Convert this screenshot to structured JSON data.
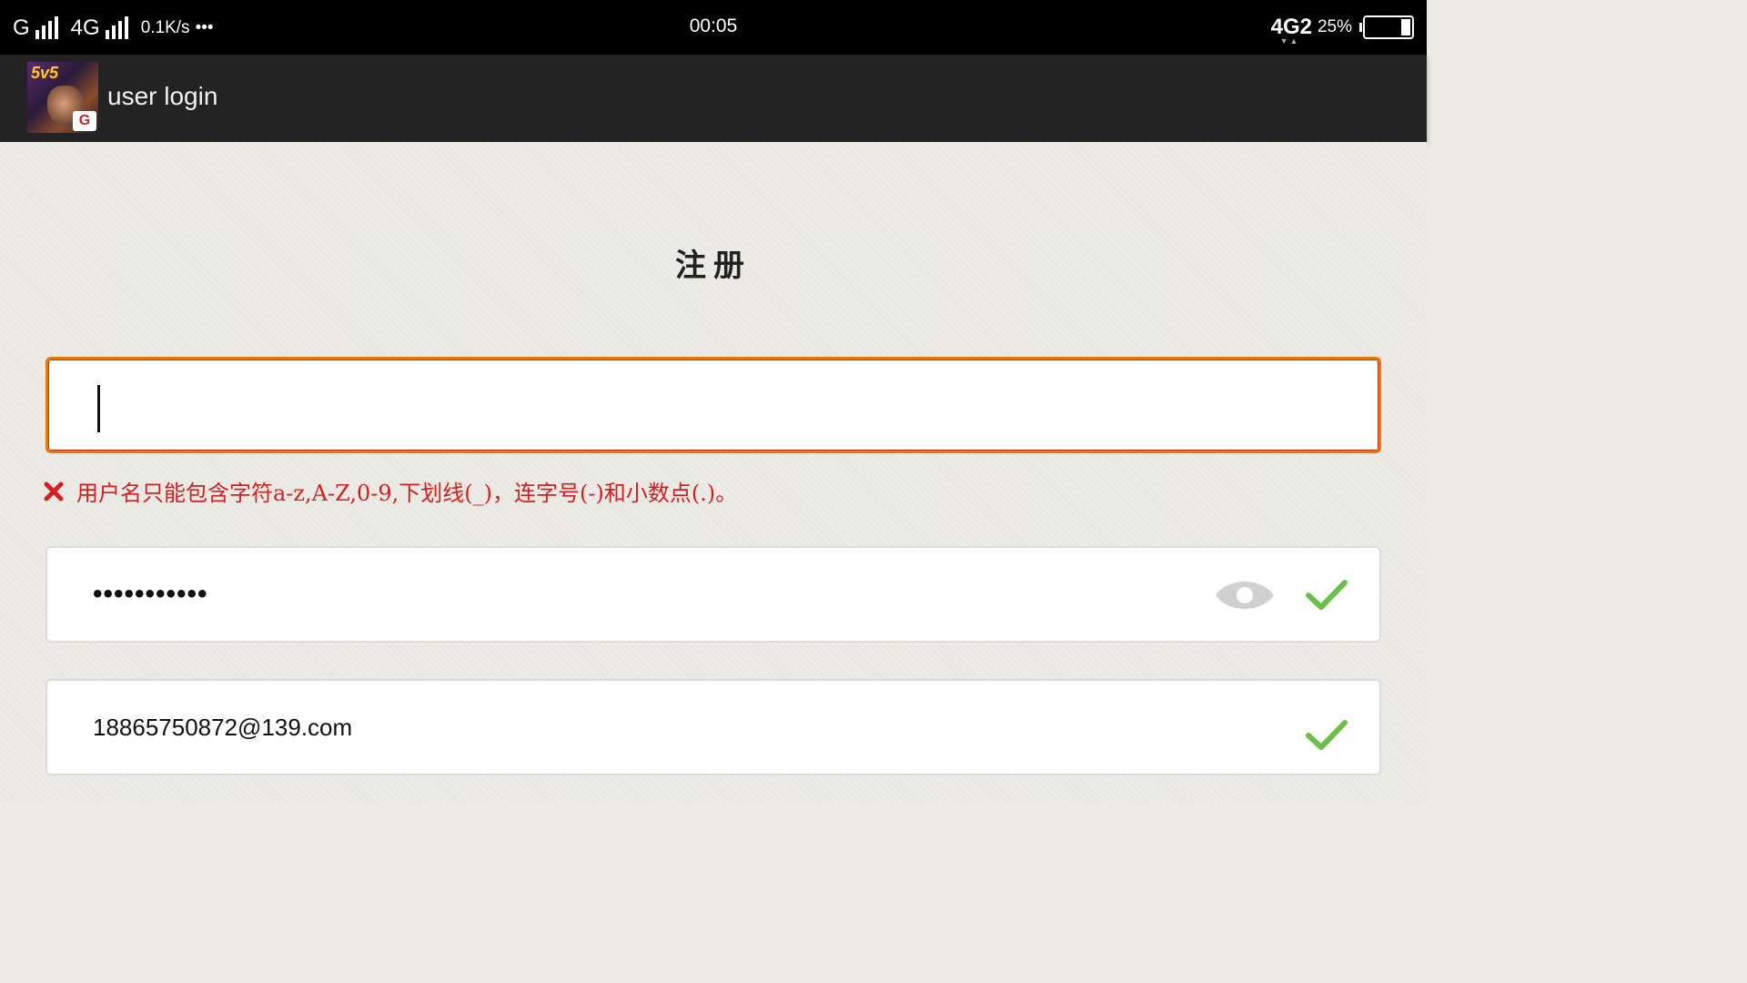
{
  "status_bar": {
    "carrier1": "G",
    "carrier2": "4G",
    "net_speed": "0.1K/s",
    "more": "•••",
    "time": "00:05",
    "network": "4G2",
    "battery": "25%"
  },
  "app_bar": {
    "icon_badge": "5v5",
    "title": "user login"
  },
  "page": {
    "title": "注册"
  },
  "username": {
    "value": "",
    "error": "用户名只能包含字符a-z,A-Z,0-9,下划线(_)，连字号(-)和小数点(.)。"
  },
  "password": {
    "value": "•••••••••••"
  },
  "email": {
    "value": "18865750872@139.com"
  },
  "colors": {
    "accent_border": "#e8780a",
    "error": "#d42020",
    "success": "#6cc04a",
    "eye": "#d0d0d0"
  },
  "icons": {
    "error": "close-x-icon",
    "visibility": "eye-icon",
    "valid": "check-icon"
  }
}
